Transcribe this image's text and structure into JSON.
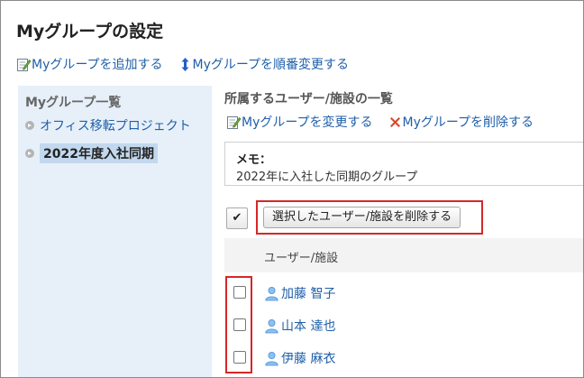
{
  "page": {
    "title": "Myグループの設定"
  },
  "toolbar": {
    "add_label": "Myグループを追加する",
    "reorder_label": "Myグループを順番変更する"
  },
  "sidebar": {
    "title": "Myグループ一覧",
    "items": [
      {
        "label": "オフィス移転プロジェクト",
        "selected": false
      },
      {
        "label": "2022年度入社同期",
        "selected": true
      }
    ]
  },
  "main": {
    "title": "所属するユーザー/施設の一覧",
    "change_label": "Myグループを変更する",
    "delete_group_label": "Myグループを削除する",
    "memo_label": "メモ：",
    "memo_text": "2022年に入社した同期のグループ",
    "select_all_glyph": "✔",
    "delete_selected_label": "選択したユーザー/施設を削除する",
    "column_header": "ユーザー/施設",
    "users": [
      {
        "name": "加藤 智子"
      },
      {
        "name": "山本 達也"
      },
      {
        "name": "伊藤 麻衣"
      }
    ]
  },
  "icons": {
    "edit": "edit-icon",
    "reorder": "up-down-arrow-icon",
    "delete": "delete-x-icon",
    "user": "user-icon",
    "bullet": "bullet-arrow-icon"
  },
  "colors": {
    "link": "#1f5fa8",
    "sidebar_bg": "#e7f0f9",
    "selected_bg": "#c2d8ee",
    "delete_x": "#d9482c",
    "highlight": "#d62728",
    "user_icon": "#4a90d9"
  }
}
